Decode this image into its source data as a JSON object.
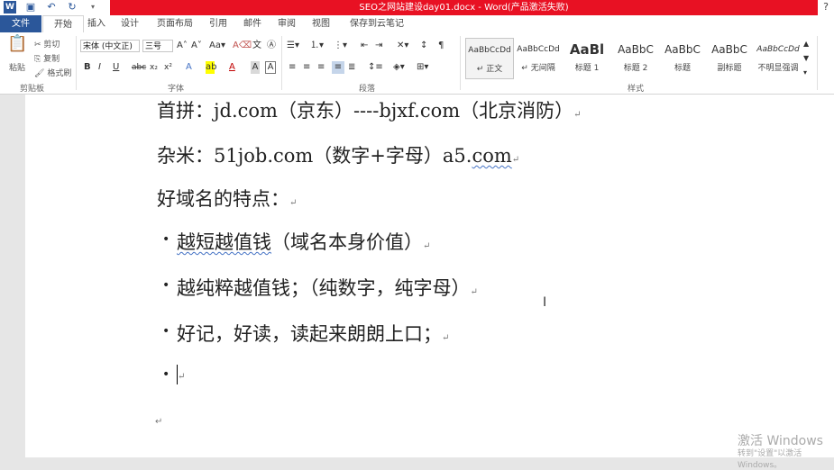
{
  "window": {
    "title": "SEO之网站建设day01.docx - Word(产品激活失败)",
    "help": "?",
    "qat_icons": [
      "word-logo-icon",
      "save-icon",
      "undo-icon",
      "redo-icon",
      "customize-qat-icon"
    ]
  },
  "tabs": [
    "文件",
    "开始",
    "插入",
    "设计",
    "页面布局",
    "引用",
    "邮件",
    "审阅",
    "视图",
    "保存到云笔记"
  ],
  "ribbon": {
    "clipboard": {
      "paste": "粘贴",
      "cut": "剪切",
      "copy": "复制",
      "format_painter": "格式刷",
      "group": "剪贴板"
    },
    "font": {
      "font_name": "宋体 (中文正⁠)",
      "font_size": "三号",
      "group": "字体",
      "buttons": [
        "B",
        "I",
        "U",
        "abc",
        "x₂",
        "x²",
        "A",
        "A",
        "Aa",
        "A",
        "A"
      ]
    },
    "paragraph": {
      "group": "段落"
    },
    "styles": {
      "group": "样式",
      "items": [
        {
          "preview": "AaBbCcDd",
          "name": "↵ 正文"
        },
        {
          "preview": "AaBbCcDd",
          "name": "↵ 无间隔"
        },
        {
          "preview": "AaBl",
          "name": "标题 1"
        },
        {
          "preview": "AaBbC",
          "name": "标题 2"
        },
        {
          "preview": "AaBbC",
          "name": "标题"
        },
        {
          "preview": "AaBbC",
          "name": "副标题"
        },
        {
          "preview": "AaBbCcDd",
          "name": "不明显强调"
        }
      ]
    }
  },
  "document": {
    "lines": [
      {
        "text": "首拼：jd.com（京东）----bjxf.com（北京消防）",
        "mark": "↵"
      },
      {
        "prefix": "杂米：51job.com（数字+字母）a5.",
        "spell": "com",
        "mark": "↵"
      },
      {
        "text": "好域名的特点：",
        "mark": "↵"
      }
    ],
    "bullets": [
      {
        "spell": "越短越值钱",
        "rest": "（域名本身价值）",
        "mark": "↵"
      },
      {
        "text": "越纯粹越值钱；（纯数字，纯字母）",
        "mark": "↵"
      },
      {
        "text": "好记，好读，读起来朗朗上口；",
        "mark": "↵"
      },
      {
        "text": "",
        "mark": "↵"
      }
    ],
    "trailing_mark": "↵",
    "bullet_char": "•"
  },
  "watermark": {
    "line1": "激活 Windows",
    "line2": "转到\"设置\"以激活 Windows。"
  }
}
